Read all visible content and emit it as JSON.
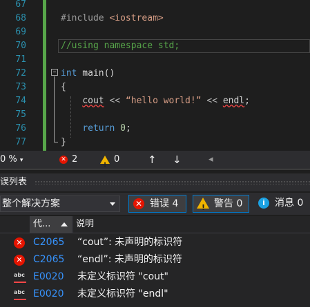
{
  "editor": {
    "lines": [
      {
        "num": "67",
        "html": ""
      },
      {
        "num": "68",
        "html": "<span class=\"pp\">#include</span> <span class=\"str\">&lt;iostream&gt;</span>"
      },
      {
        "num": "69",
        "html": ""
      },
      {
        "num": "70",
        "html": "<span class=\"cm\">//using namespace std;</span>"
      },
      {
        "num": "71",
        "html": ""
      },
      {
        "num": "72",
        "html": "<span class=\"kw\">int</span> main()"
      },
      {
        "num": "73",
        "html": "{"
      },
      {
        "num": "74",
        "html": "    <span class=\"squiggle\">cout</span> <span class=\"op\">&lt;&lt;</span> <span class=\"str\">“hello world!”</span> <span class=\"op\">&lt;&lt;</span> <span class=\"squiggle\">endl</span>;"
      },
      {
        "num": "75",
        "html": ""
      },
      {
        "num": "76",
        "html": "    <span class=\"kw\">return</span> <span class=\"num\">0</span>;"
      },
      {
        "num": "77",
        "html": "}"
      }
    ]
  },
  "statusstrip": {
    "zoom": "0 %",
    "errors": "2",
    "warnings": "0",
    "up_arrow": "↑",
    "down_arrow": "↓",
    "left_arrow": "◂"
  },
  "panel": {
    "title": "误列表",
    "scope": "整个解决方案",
    "filter_errors": "错误 4",
    "filter_warnings": "警告 0",
    "filter_messages": "消息 0",
    "col_code": "代...",
    "col_desc": "说明"
  },
  "rows": [
    {
      "icon": "error-icon",
      "code": "C2065",
      "desc": "“cout”: 未声明的标识符"
    },
    {
      "icon": "error-icon",
      "code": "C2065",
      "desc": "“endl”: 未声明的标识符"
    },
    {
      "icon": "intellisense-error-icon",
      "code": "E0020",
      "desc": "未定义标识符 \"cout\""
    },
    {
      "icon": "intellisense-error-icon",
      "code": "E0020",
      "desc": "未定义标识符 \"endl\""
    }
  ],
  "colors": {
    "error": "#e51400",
    "warning": "#f0b400",
    "info": "#1ba1e2",
    "accent": "#007acc",
    "line_number": "#2b91af"
  }
}
